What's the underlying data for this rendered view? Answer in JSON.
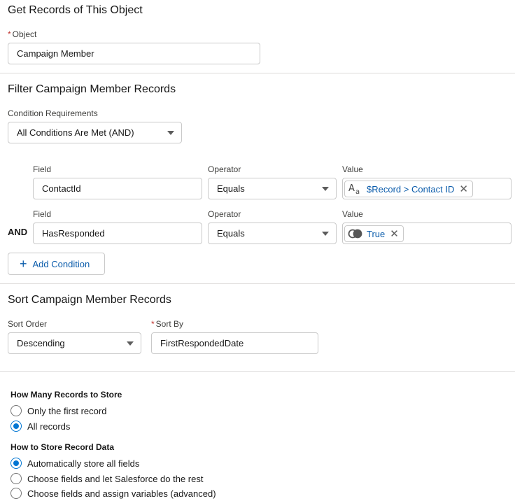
{
  "get_records": {
    "title": "Get Records of This Object",
    "required_mark": "*",
    "object_label": "Object",
    "object_value": "Campaign Member"
  },
  "filter": {
    "title": "Filter Campaign Member Records",
    "condition_requirements_label": "Condition Requirements",
    "condition_requirements_value": "All Conditions Are Met (AND)",
    "conditions": [
      {
        "field_label": "Field",
        "field_value": "ContactId",
        "operator_label": "Operator",
        "operator_value": "Equals",
        "value_label": "Value",
        "value_pill": "$Record > Contact ID",
        "value_icon": "text-type-icon",
        "connector": ""
      },
      {
        "field_label": "Field",
        "field_value": "HasResponded",
        "operator_label": "Operator",
        "operator_value": "Equals",
        "value_label": "Value",
        "value_pill": "True",
        "value_icon": "boolean-toggle-icon",
        "connector": "AND"
      }
    ],
    "add_condition_label": "Add Condition"
  },
  "sort": {
    "title": "Sort Campaign Member Records",
    "sort_order_label": "Sort Order",
    "sort_order_value": "Descending",
    "required_mark": "*",
    "sort_by_label": "Sort By",
    "sort_by_value": "FirstRespondedDate"
  },
  "how_many": {
    "title": "How Many Records to Store",
    "options": [
      {
        "label": "Only the first record",
        "checked": false
      },
      {
        "label": "All records",
        "checked": true
      }
    ]
  },
  "how_store": {
    "title": "How to Store Record Data",
    "options": [
      {
        "label": "Automatically store all fields",
        "checked": true
      },
      {
        "label": "Choose fields and let Salesforce do the rest",
        "checked": false
      },
      {
        "label": "Choose fields and assign variables (advanced)",
        "checked": false
      }
    ]
  },
  "colors": {
    "accent": "#0176d3",
    "link": "#0b5cab",
    "border": "#c9c9c9",
    "divider": "#dddbda",
    "required": "#c23934"
  }
}
